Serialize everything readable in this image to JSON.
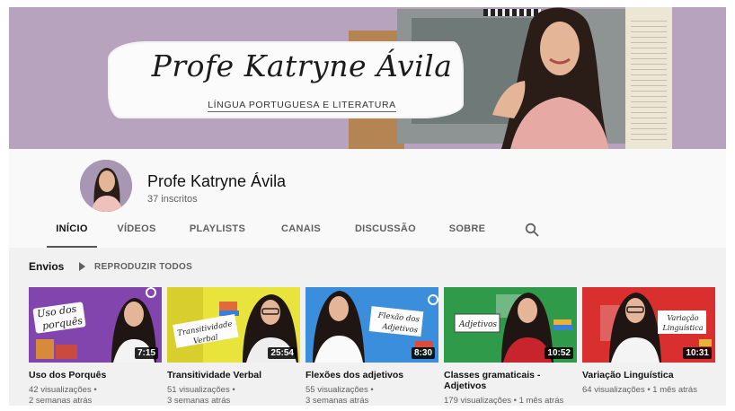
{
  "banner": {
    "script_title": "Profe Katryne Ávila",
    "tagline": "LÍNGUA PORTUGUESA E LITERATURA"
  },
  "channel": {
    "name": "Profe Katryne Ávila",
    "subscribers": "37 inscritos"
  },
  "tabs": [
    {
      "label": "INÍCIO",
      "active": true
    },
    {
      "label": "VÍDEOS"
    },
    {
      "label": "PLAYLISTS"
    },
    {
      "label": "CANAIS"
    },
    {
      "label": "DISCUSSÃO"
    },
    {
      "label": "SOBRE"
    }
  ],
  "search_icon": "search-icon",
  "uploads": {
    "title": "Envios",
    "play_all": "REPRODUZIR TODOS",
    "play_icon": "play-icon"
  },
  "videos": [
    {
      "title": "Uso dos Porquês",
      "views": "42 visualizações •",
      "age": "2 semanas atrás",
      "duration": "7:15",
      "thumb_text": "Uso dos porquês",
      "thumb_color": "#7b3fa6"
    },
    {
      "title": "Transitividade Verbal",
      "views": "51 visualizações •",
      "age": "3 semanas atrás",
      "duration": "25:54",
      "thumb_text": "Transitividade Verbal",
      "thumb_color": "#e9e43c"
    },
    {
      "title": "Flexões dos adjetivos",
      "views": "55 visualizações •",
      "age": "3 semanas atrás",
      "duration": "8:30",
      "thumb_text": "Flexão dos Adjetivos",
      "thumb_color": "#2f86d6"
    },
    {
      "title": "Classes gramaticais - Adjetivos",
      "views": "179 visualizações • 1 mês atrás",
      "age": "",
      "duration": "10:52",
      "thumb_text": "Adjetivos",
      "thumb_color": "#2f9a4a"
    },
    {
      "title": "Variação Linguística",
      "views": "64 visualizações • 1 mês atrás",
      "age": "",
      "duration": "10:31",
      "thumb_text": "Variação Linguística",
      "thumb_color": "#d9302f"
    }
  ]
}
